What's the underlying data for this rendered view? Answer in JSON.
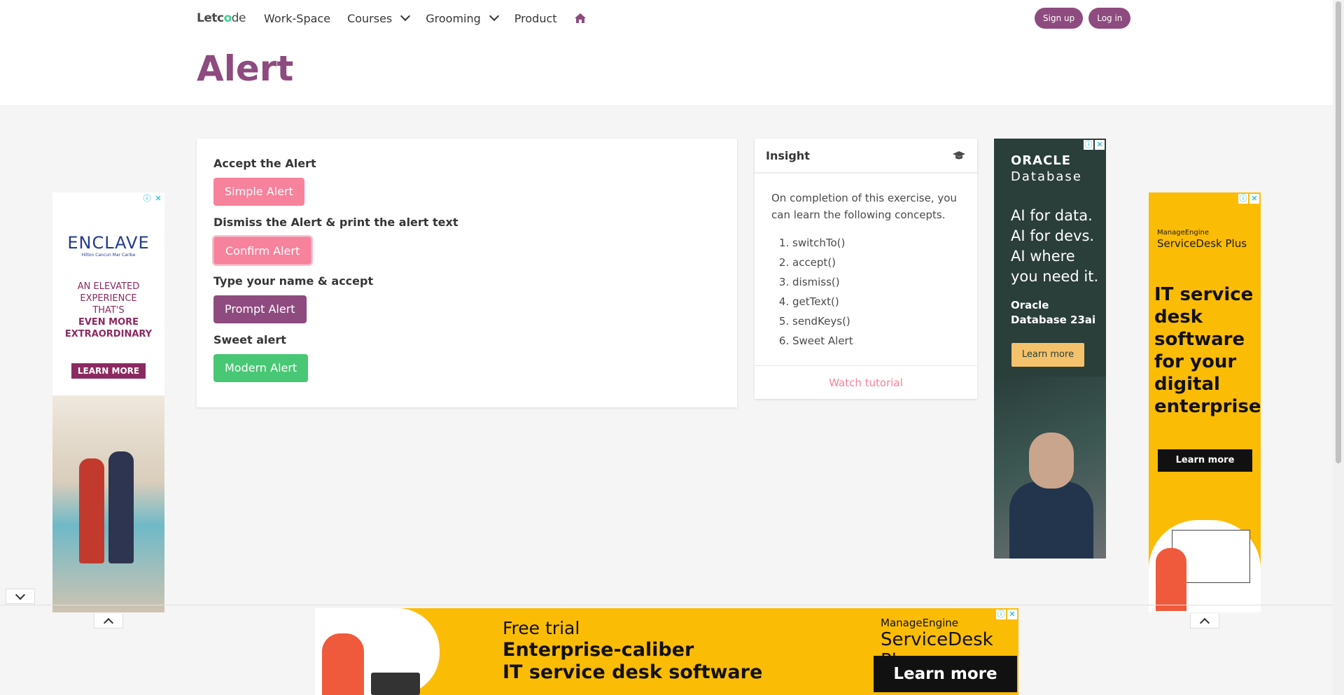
{
  "nav": {
    "logo": {
      "part1": "Let",
      "part2": "c",
      "part3": "o",
      "part4": "de"
    },
    "items": [
      {
        "label": "Work-Space"
      },
      {
        "label": "Courses"
      },
      {
        "label": "Grooming"
      },
      {
        "label": "Product"
      }
    ],
    "home_icon": "home-icon",
    "signup_label": "Sign up",
    "login_label": "Log in"
  },
  "page": {
    "title": "Alert"
  },
  "alerts": {
    "accept_label": "Accept the Alert",
    "simple_btn": "Simple Alert",
    "dismiss_label": "Dismiss the Alert & print the alert text",
    "confirm_btn": "Confirm Alert",
    "prompt_label": "Type your name & accept",
    "prompt_btn": "Prompt Alert",
    "sweet_label": "Sweet alert",
    "modern_btn": "Modern Alert"
  },
  "insight": {
    "title": "Insight",
    "icon": "graduation-cap-icon",
    "intro": "On completion of this exercise, you can learn the following concepts.",
    "concepts": [
      "switchTo()",
      "accept()",
      "dismiss()",
      "getText()",
      "sendKeys()",
      "Sweet Alert"
    ],
    "footer_link": "Watch tutorial"
  },
  "ads": {
    "enclave": {
      "logo": "ENCLAVE",
      "sub": "Hilton Cancun Mar Caribe",
      "line1": "AN ELEVATED",
      "line2": "EXPERIENCE",
      "line3": "THAT'S",
      "line4": "EVEN MORE",
      "line5": "EXTRAORDINARY",
      "cta": "LEARN MORE"
    },
    "oracle": {
      "logo": "ORACLE",
      "sub": "Database",
      "text1": "AI for data.",
      "text2": "AI for devs.",
      "text3": "AI where you need it.",
      "db1": "Oracle",
      "db2": "Database 23ai",
      "cta": "Learn more"
    },
    "manageengine": {
      "brand": "ManageEngine",
      "product": "ServiceDesk Plus",
      "headline1": "IT service",
      "headline2": "desk",
      "headline3": "software",
      "headline4": "for your",
      "headline5": "digital",
      "headline6": "enterprise",
      "cta": "Learn more"
    },
    "bottom": {
      "free": "Free trial",
      "line1": "Enterprise-caliber",
      "line2": "IT service desk software",
      "brand": "ManageEngine",
      "product": "ServiceDesk Plus",
      "cta": "Learn more"
    },
    "adchoices": "ⓘ",
    "close": "✕"
  },
  "colors": {
    "primary": "#8e4b7f",
    "pink": "#f6829c",
    "green": "#48c774"
  }
}
